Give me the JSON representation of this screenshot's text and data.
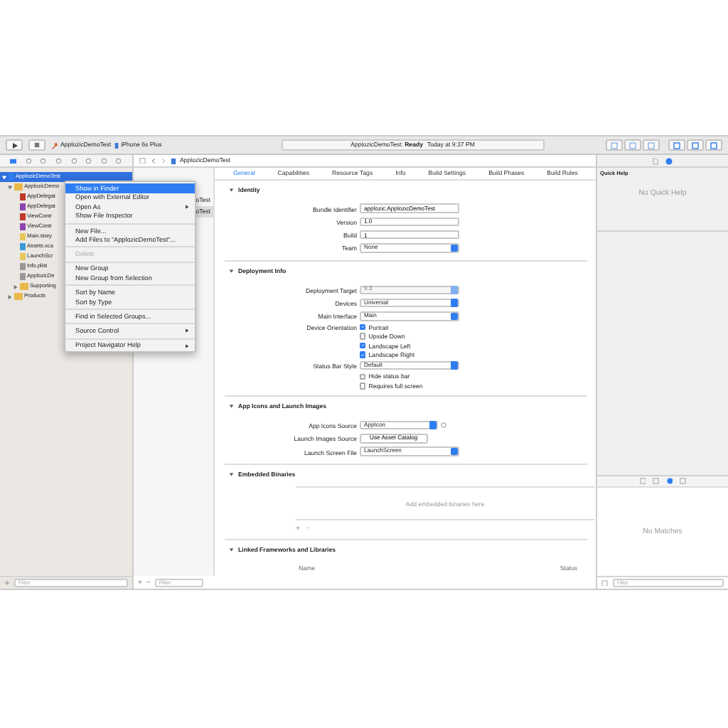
{
  "toolbar": {
    "scheme": "ApplozicDemoTest",
    "device": "iPhone 6s Plus",
    "activity": "ApplozicDemoTest: **Ready**",
    "activity_time": "Today at 9:37 PM"
  },
  "jump_bar": {
    "file": "ApplozicDemoTest"
  },
  "navigator": {
    "items": [
      {
        "label": "ApplozicDemoTest",
        "kind": "project",
        "selected": true,
        "expanded": true,
        "children": [
          {
            "label": "ApplozicDemo",
            "kind": "folder",
            "selected": false,
            "expanded": true,
            "children": [
              {
                "label": "AppDelegat",
                "kind": "header",
                "selected": false
              },
              {
                "label": "AppDelegat",
                "kind": "source",
                "selected": false
              },
              {
                "label": "ViewContr",
                "kind": "header",
                "selected": false
              },
              {
                "label": "ViewContr",
                "kind": "source",
                "selected": false
              },
              {
                "label": "Main.story",
                "kind": "storyboard",
                "selected": false
              },
              {
                "label": "Assets.xca",
                "kind": "assets",
                "selected": false
              },
              {
                "label": "LaunchScr",
                "kind": "storyboard",
                "selected": false
              },
              {
                "label": "Info.plist",
                "kind": "plist",
                "selected": false
              },
              {
                "label": "ApplozicDe",
                "kind": "plist",
                "selected": false
              },
              {
                "label": "Supporting",
                "kind": "folder",
                "selected": false,
                "expanded": false
              }
            ]
          },
          {
            "label": "Products",
            "kind": "folder",
            "selected": false,
            "expanded": false
          }
        ]
      }
    ],
    "filter_placeholder": "Filter"
  },
  "context_menu": {
    "groups": [
      [
        {
          "label": "Show in Finder",
          "selected": true,
          "disabled": false,
          "submenu": false
        },
        {
          "label": "Open with External Editor",
          "selected": false,
          "disabled": false,
          "submenu": false
        },
        {
          "label": "Open As",
          "selected": false,
          "disabled": false,
          "submenu": true
        },
        {
          "label": "Show File Inspector",
          "selected": false,
          "disabled": false,
          "submenu": false
        }
      ],
      [
        {
          "label": "New File...",
          "selected": false,
          "disabled": false,
          "submenu": false
        },
        {
          "label": "Add Files to “ApplozicDemoTest”...",
          "selected": false,
          "disabled": false,
          "submenu": false
        }
      ],
      [
        {
          "label": "Delete",
          "selected": false,
          "disabled": true,
          "submenu": false
        }
      ],
      [
        {
          "label": "New Group",
          "selected": false,
          "disabled": false,
          "submenu": false
        },
        {
          "label": "New Group from Selection",
          "selected": false,
          "disabled": false,
          "submenu": false
        }
      ],
      [
        {
          "label": "Sort by Name",
          "selected": false,
          "disabled": false,
          "submenu": false
        },
        {
          "label": "Sort by Type",
          "selected": false,
          "disabled": false,
          "submenu": false
        }
      ],
      [
        {
          "label": "Find in Selected Groups...",
          "selected": false,
          "disabled": false,
          "submenu": false
        }
      ],
      [
        {
          "label": "Source Control",
          "selected": false,
          "disabled": false,
          "submenu": true
        }
      ],
      [
        {
          "label": "Project Navigator Help",
          "selected": false,
          "disabled": false,
          "submenu": true
        }
      ]
    ]
  },
  "targets": [
    {
      "label": "oTest",
      "selected": false
    },
    {
      "label": "oTest",
      "selected": true
    }
  ],
  "editor_tabs": [
    {
      "label": "General",
      "selected": true
    },
    {
      "label": "Capabilities",
      "selected": false
    },
    {
      "label": "Resource Tags",
      "selected": false
    },
    {
      "label": "Info",
      "selected": false
    },
    {
      "label": "Build Settings",
      "selected": false
    },
    {
      "label": "Build Phases",
      "selected": false
    },
    {
      "label": "Build Rules",
      "selected": false
    }
  ],
  "sections": [
    {
      "title": "Identity",
      "rows": [
        {
          "kind": "field",
          "label": "Bundle Identifier",
          "value": "applozic.ApplozicDemoTest"
        },
        {
          "kind": "field",
          "label": "Version",
          "value": "1.0"
        },
        {
          "kind": "field",
          "label": "Build",
          "value": "1"
        },
        {
          "kind": "popup",
          "label": "Team",
          "value": "None",
          "disabled": false
        }
      ]
    },
    {
      "title": "Deployment Info",
      "rows": [
        {
          "kind": "popup",
          "label": "Deployment Target",
          "value": "9.3",
          "disabled": true
        },
        {
          "kind": "popup",
          "label": "Devices",
          "value": "Universal",
          "disabled": false
        },
        {
          "kind": "popup",
          "label": "Main Interface",
          "value": "Main",
          "disabled": false
        },
        {
          "kind": "checks",
          "label": "Device Orientation",
          "options": [
            {
              "label": "Portrait",
              "checked": true
            },
            {
              "label": "Upside Down",
              "checked": false
            },
            {
              "label": "Landscape Left",
              "checked": true
            },
            {
              "label": "Landscape Right",
              "checked": true
            }
          ]
        },
        {
          "kind": "popup",
          "label": "Status Bar Style",
          "value": "Default",
          "disabled": false
        },
        {
          "kind": "checks",
          "options": [
            {
              "label": "Hide status bar",
              "checked": false
            },
            {
              "label": "Requires full screen",
              "checked": false
            }
          ]
        }
      ]
    },
    {
      "title": "App Icons and Launch Images",
      "rows": [
        {
          "kind": "popup-info",
          "label": "App Icons Source",
          "value": "AppIcon",
          "disabled": false
        },
        {
          "kind": "button",
          "label": "Launch Images Source",
          "value": "Use Asset Catalog"
        },
        {
          "kind": "popup",
          "label": "Launch Screen File",
          "value": "LaunchScreen",
          "disabled": false
        }
      ]
    },
    {
      "title": "Embedded Binaries",
      "rows": [
        {
          "kind": "drop-list",
          "value": "Add embedded binaries here",
          "add": "+",
          "remove": "−"
        }
      ]
    },
    {
      "title": "Linked Frameworks and Libraries",
      "rows": [
        {
          "kind": "table-header",
          "columns": [
            "Name",
            "Status"
          ]
        }
      ]
    }
  ],
  "editor_bottom": {
    "add": "+",
    "remove": "−",
    "filter_placeholder": "Filter"
  },
  "inspector": {
    "title": "Quick Help",
    "empty": "No Quick Help",
    "library_empty": "No Matches",
    "filter_placeholder": "Filter"
  }
}
